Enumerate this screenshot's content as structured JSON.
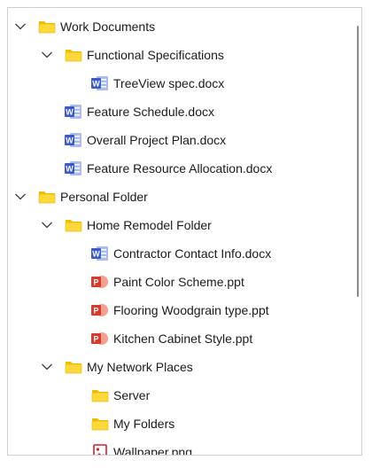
{
  "colors": {
    "folder_back": "#f0c000",
    "folder_front": "#ffd83b",
    "word_blue": "#3b5bcc",
    "ppt_red": "#d63c2a",
    "image_red": "#d21f2b",
    "text": "#1b1b1b"
  },
  "tree": {
    "work_documents": {
      "label": "Work Documents",
      "functional_specifications": {
        "label": "Functional Specifications",
        "treeview_spec": "TreeView spec.docx"
      },
      "feature_schedule": "Feature Schedule.docx",
      "overall_project_plan": "Overall Project Plan.docx",
      "feature_resource_allocation": "Feature Resource Allocation.docx"
    },
    "personal_folder": {
      "label": "Personal Folder",
      "home_remodel_folder": {
        "label": "Home Remodel Folder",
        "contractor_contact_info": "Contractor Contact Info.docx",
        "paint_color_scheme": "Paint Color Scheme.ppt",
        "flooring_woodgrain": "Flooring Woodgrain type.ppt",
        "kitchen_cabinet_style": "Kitchen Cabinet Style.ppt"
      },
      "my_network_places": {
        "label": "My Network Places",
        "server": "Server",
        "my_folders": "My Folders"
      },
      "wallpaper": "Wallpaper.png"
    }
  }
}
